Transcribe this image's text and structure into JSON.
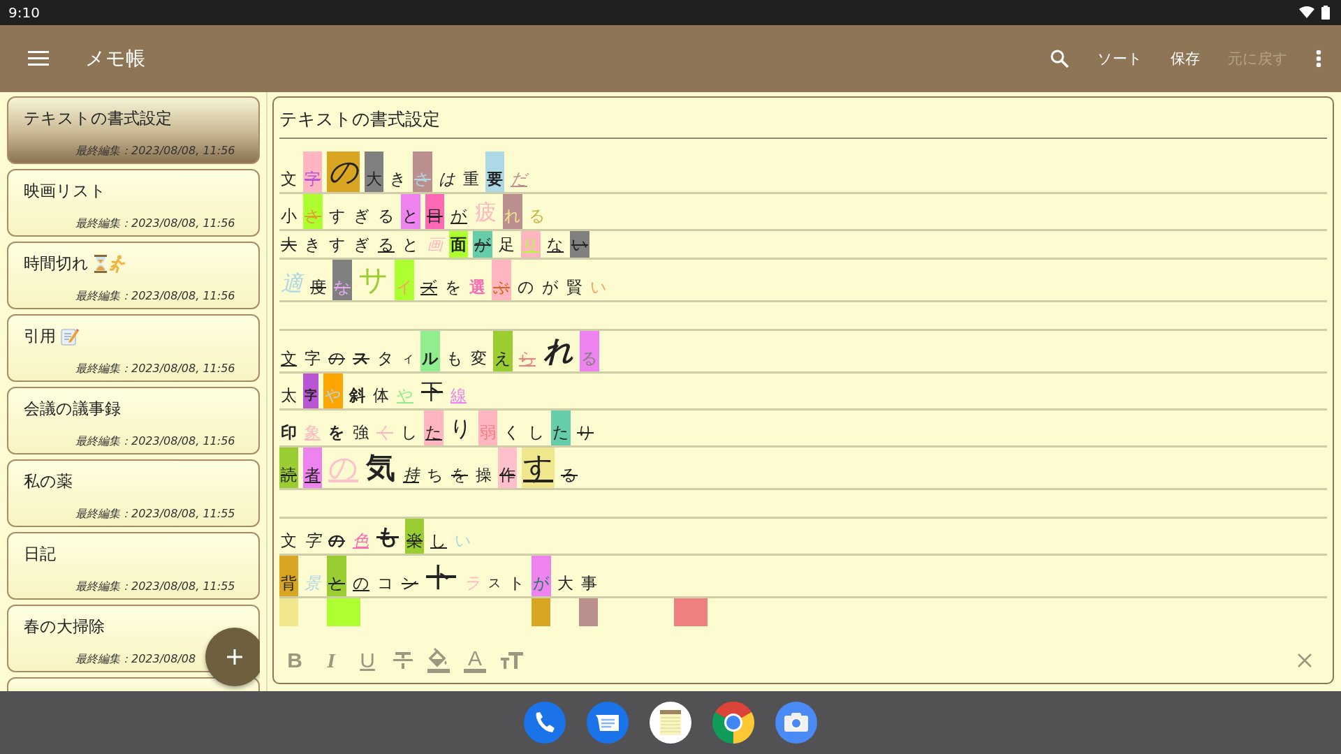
{
  "status_bar": {
    "time": "9:10"
  },
  "app_bar": {
    "title": "メモ帳",
    "actions": [
      {
        "label": "ソート",
        "disabled": false
      },
      {
        "label": "保存",
        "disabled": false
      },
      {
        "label": "元に戻す",
        "disabled": true
      }
    ]
  },
  "notes": [
    {
      "title": "テキストの書式設定",
      "edited": "最終編集：2023/08/08, 11:56",
      "selected": true
    },
    {
      "title": "映画リスト",
      "edited": "最終編集：2023/08/08, 11:56",
      "selected": false
    },
    {
      "title": "時間切れ",
      "icons": [
        {
          "kind": "hourglass"
        },
        {
          "kind": "runner"
        }
      ],
      "edited": "最終編集：2023/08/08, 11:56",
      "selected": false
    },
    {
      "title": "引用",
      "icons": [
        {
          "kind": "memo"
        }
      ],
      "edited": "最終編集：2023/08/08, 11:56",
      "selected": false
    },
    {
      "title": "会議の議事録",
      "edited": "最終編集：2023/08/08, 11:56",
      "selected": false
    },
    {
      "title": "私の薬",
      "edited": "最終編集：2023/08/08, 11:55",
      "selected": false
    },
    {
      "title": "日記",
      "edited": "最終編集：2023/08/08, 11:55",
      "selected": false
    },
    {
      "title": "春の大掃除",
      "edited": "最終編集：2023/08/08",
      "selected": false
    }
  ],
  "editor": {
    "title": "テキストの書式設定",
    "lines": [
      {
        "kind": "text",
        "chars": [
          {
            "t": "文",
            "kind": "normal"
          },
          {
            "t": "字",
            "kind": "normal",
            "highlight": {
              "color": "#ffb6c1"
            },
            "color": "#ba55d3",
            "strike": true
          },
          {
            "t": "の",
            "kind": "huge",
            "highlight": {
              "color": "#daa520"
            },
            "italic": true
          },
          {
            "t": "大",
            "kind": "normal",
            "highlight": {
              "color": "#808080"
            }
          },
          {
            "t": "き",
            "kind": "normal"
          },
          {
            "t": "さ",
            "kind": "normal",
            "highlight": {
              "color": "#bc8f8f"
            },
            "color": "#add8e6",
            "strike": true
          },
          {
            "t": "は",
            "kind": "normal",
            "italic": true
          },
          {
            "t": "重",
            "kind": "normal"
          },
          {
            "t": "要",
            "kind": "normal",
            "highlight": {
              "color": "#add8e6"
            },
            "bold": true
          },
          {
            "t": "だ",
            "kind": "normal",
            "color": "#bc8f8f",
            "italic": true,
            "underline": true
          }
        ]
      },
      {
        "kind": "text",
        "chars": [
          {
            "t": "小",
            "kind": "normal"
          },
          {
            "t": "さ",
            "kind": "normal",
            "highlight": {
              "color": "#adff2f"
            },
            "color": "#e0a030",
            "strike": true
          },
          {
            "t": "す",
            "kind": "normal"
          },
          {
            "t": "ぎ",
            "kind": "normal"
          },
          {
            "t": "る",
            "kind": "normal"
          },
          {
            "t": "と",
            "kind": "normal",
            "highlight": {
              "color": "#ee82ee"
            }
          },
          {
            "t": "目",
            "kind": "normal",
            "highlight": {
              "color": "#ff69b4"
            },
            "strike": true
          },
          {
            "t": "が",
            "kind": "normal",
            "underline": true
          },
          {
            "t": "疲",
            "kind": "large",
            "color": "#ffb6c1"
          },
          {
            "t": "れ",
            "kind": "normal",
            "highlight": {
              "color": "#bc8f8f"
            },
            "color": "#f0e68c"
          },
          {
            "t": "る",
            "kind": "normal",
            "color": "#c8b440"
          }
        ]
      },
      {
        "kind": "text",
        "chars": [
          {
            "t": "大",
            "kind": "normal",
            "strike": true
          },
          {
            "t": "き",
            "kind": "normal"
          },
          {
            "t": "す",
            "kind": "normal"
          },
          {
            "t": "ぎ",
            "kind": "normal"
          },
          {
            "t": "る",
            "kind": "normal",
            "underline": true
          },
          {
            "t": "と",
            "kind": "normal"
          },
          {
            "t": "画",
            "kind": "normal",
            "color": "#ffb6c1",
            "italic": true
          },
          {
            "t": "面",
            "kind": "normal",
            "highlight": {
              "color": "#adff2f"
            },
            "bold": true
          },
          {
            "t": "が",
            "kind": "normal",
            "highlight": {
              "color": "#66cdaa"
            },
            "strike": true
          },
          {
            "t": "足",
            "kind": "normal"
          },
          {
            "t": "り",
            "kind": "normal",
            "highlight": {
              "color": "#ffb6c1"
            },
            "color": "#adff2f",
            "underline": true
          },
          {
            "t": "な",
            "kind": "normal",
            "underline": true
          },
          {
            "t": "い",
            "kind": "normal",
            "highlight": {
              "color": "#808080"
            },
            "strike": true
          }
        ]
      },
      {
        "kind": "text",
        "chars": [
          {
            "t": "適",
            "kind": "large",
            "color": "#add8e6",
            "italic": true
          },
          {
            "t": "度",
            "kind": "normal",
            "strike": true
          },
          {
            "t": "な",
            "kind": "normal",
            "highlight": {
              "color": "#808080"
            },
            "color": "#e6a8f5",
            "strike": true
          },
          {
            "t": "サ",
            "kind": "huge",
            "color": "#9acd32"
          },
          {
            "t": "イ",
            "kind": "normal",
            "highlight": {
              "color": "#adff2f"
            },
            "color": "#f4a460"
          },
          {
            "t": "ズ",
            "kind": "normal",
            "underline": true,
            "strike": true
          },
          {
            "t": "を",
            "kind": "normal"
          },
          {
            "t": "選",
            "kind": "normal",
            "color": "#ff69b4",
            "bold": true
          },
          {
            "t": "ぶ",
            "kind": "normal",
            "highlight": {
              "color": "#ffb6c1"
            },
            "color": "#d2691e",
            "strike": true
          },
          {
            "t": "の",
            "kind": "normal"
          },
          {
            "t": "が",
            "kind": "normal"
          },
          {
            "t": "賢",
            "kind": "normal"
          },
          {
            "t": "い",
            "kind": "normal",
            "color": "#f4a460"
          }
        ]
      },
      {
        "kind": "blank"
      },
      {
        "kind": "text",
        "chars": [
          {
            "t": "文",
            "kind": "normal",
            "underline": true
          },
          {
            "t": "字",
            "kind": "normal"
          },
          {
            "t": "の",
            "kind": "normal",
            "strike": true
          },
          {
            "t": "ス",
            "kind": "normal",
            "strike": true,
            "bold": true
          },
          {
            "t": "タ",
            "kind": "normal"
          },
          {
            "t": "ィ",
            "kind": "small"
          },
          {
            "t": "ル",
            "kind": "normal",
            "highlight": {
              "color": "#90ee90"
            },
            "bold": true
          },
          {
            "t": "も",
            "kind": "normal"
          },
          {
            "t": "変",
            "kind": "normal"
          },
          {
            "t": "え",
            "kind": "normal",
            "highlight": {
              "color": "#9acd32"
            }
          },
          {
            "t": "ら",
            "kind": "normal",
            "color": "#f08080",
            "strike": true,
            "underline": true
          },
          {
            "t": "れ",
            "kind": "huge",
            "italic": true,
            "bold": true
          },
          {
            "t": "る",
            "kind": "normal",
            "highlight": {
              "color": "#ee82ee"
            },
            "color": "#808080"
          }
        ]
      },
      {
        "kind": "text",
        "chars": [
          {
            "t": "太",
            "kind": "normal"
          },
          {
            "t": "字",
            "kind": "small",
            "highlight": {
              "color": "#ba55d3"
            },
            "bold": true
          },
          {
            "t": "や",
            "kind": "normal",
            "highlight": {
              "color": "#ffa500"
            },
            "color": "#add8e6"
          },
          {
            "t": "斜",
            "kind": "normal",
            "bold": true
          },
          {
            "t": "体",
            "kind": "normal"
          },
          {
            "t": "や",
            "kind": "normal",
            "color": "#90ee90",
            "underline": true
          },
          {
            "t": "下",
            "kind": "large",
            "strike": true
          },
          {
            "t": "線",
            "kind": "normal",
            "color": "#ee82ee",
            "underline": true
          }
        ]
      },
      {
        "kind": "text",
        "chars": [
          {
            "t": "印",
            "kind": "normal",
            "bold": true
          },
          {
            "t": "象",
            "kind": "normal",
            "color": "#ffb6c1",
            "underline": true
          },
          {
            "t": "を",
            "kind": "normal",
            "bold": true
          },
          {
            "t": "強",
            "kind": "normal"
          },
          {
            "t": "く",
            "kind": "normal",
            "color": "#ffb6c1",
            "strike": true
          },
          {
            "t": "し",
            "kind": "normal"
          },
          {
            "t": "た",
            "kind": "normal",
            "highlight": {
              "color": "#ffb6c1"
            },
            "underline": true
          },
          {
            "t": "り",
            "kind": "large"
          },
          {
            "t": "弱",
            "kind": "normal",
            "highlight": {
              "color": "#ffb6c1"
            },
            "color": "#f08080"
          },
          {
            "t": "く",
            "kind": "normal"
          },
          {
            "t": "し",
            "kind": "normal"
          },
          {
            "t": "た",
            "kind": "normal",
            "highlight": {
              "color": "#66cdaa"
            }
          },
          {
            "t": "り",
            "kind": "normal",
            "strike": true
          }
        ]
      },
      {
        "kind": "text",
        "chars": [
          {
            "t": "読",
            "kind": "normal",
            "highlight": {
              "color": "#9acd32"
            },
            "strike": true
          },
          {
            "t": "者",
            "kind": "normal",
            "highlight": {
              "color": "#ee82ee"
            },
            "underline": true
          },
          {
            "t": "の",
            "kind": "huge",
            "color": "#ffc0cb",
            "underline": true
          },
          {
            "t": "気",
            "kind": "huge",
            "bold": true
          },
          {
            "t": "持",
            "kind": "normal",
            "italic": true,
            "underline": true
          },
          {
            "t": "ち",
            "kind": "normal"
          },
          {
            "t": "を",
            "kind": "normal",
            "strike": true
          },
          {
            "t": "操",
            "kind": "normal"
          },
          {
            "t": "作",
            "kind": "normal",
            "highlight": {
              "color": "#ffc0cb"
            },
            "strike": true
          },
          {
            "t": "す",
            "kind": "huge",
            "highlight": {
              "color": "#f0e68c"
            },
            "underline": true
          },
          {
            "t": "る",
            "kind": "normal",
            "strike": true
          }
        ]
      },
      {
        "kind": "blank"
      },
      {
        "kind": "text",
        "chars": [
          {
            "t": "文",
            "kind": "normal"
          },
          {
            "t": "字",
            "kind": "normal",
            "italic": true
          },
          {
            "t": "の",
            "kind": "normal",
            "strike": true,
            "bold": true
          },
          {
            "t": "色",
            "kind": "normal",
            "color": "#ff69b4",
            "italic": true,
            "underline": true
          },
          {
            "t": "も",
            "kind": "large",
            "bold": true,
            "strike": true
          },
          {
            "t": "楽",
            "kind": "normal",
            "highlight": {
              "color": "#9acd32"
            },
            "strike": true
          },
          {
            "t": "し",
            "kind": "normal",
            "underline": true
          },
          {
            "t": "い",
            "kind": "normal",
            "color": "#add8e6"
          }
        ]
      },
      {
        "kind": "text",
        "chars": [
          {
            "t": "背",
            "kind": "normal",
            "highlight": {
              "color": "#daa520"
            }
          },
          {
            "t": "景",
            "kind": "normal",
            "color": "#add8e6",
            "italic": true
          },
          {
            "t": "と",
            "kind": "normal",
            "highlight": {
              "color": "#9acd32"
            },
            "strike": true
          },
          {
            "t": "の",
            "kind": "normal",
            "underline": true
          },
          {
            "t": "コ",
            "kind": "normal"
          },
          {
            "t": "ン",
            "kind": "normal",
            "strike": true
          },
          {
            "t": "ト",
            "kind": "huge",
            "strike": true
          },
          {
            "t": "ラ",
            "kind": "normal",
            "color": "#ffb6c1",
            "italic": true
          },
          {
            "t": "ス",
            "kind": "small"
          },
          {
            "t": "ト",
            "kind": "normal"
          },
          {
            "t": "が",
            "kind": "normal",
            "highlight": {
              "color": "#ee82ee"
            },
            "color": "#1f7a5c"
          },
          {
            "t": "大",
            "kind": "normal"
          },
          {
            "t": "事",
            "kind": "normal"
          }
        ]
      },
      {
        "kind": "clipped",
        "chars": [
          {
            "kind": "block",
            "highlight": {
              "color": "#f0e68c"
            }
          },
          {
            "kind": "gap"
          },
          {
            "kind": "wide",
            "highlight": {
              "color": "#adff2f"
            }
          },
          {
            "kind": "gap"
          },
          {
            "kind": "gap"
          },
          {
            "kind": "gap"
          },
          {
            "kind": "gap"
          },
          {
            "kind": "gap"
          },
          {
            "kind": "gap"
          },
          {
            "kind": "gap"
          },
          {
            "kind": "block",
            "highlight": {
              "color": "#daa520"
            }
          },
          {
            "kind": "gap"
          },
          {
            "kind": "block",
            "highlight": {
              "color": "#bc8f8f"
            }
          },
          {
            "kind": "gap"
          },
          {
            "kind": "gap"
          },
          {
            "kind": "gap"
          },
          {
            "kind": "wide",
            "highlight": {
              "color": "#f08080"
            }
          }
        ]
      }
    ]
  },
  "toolbar": [
    {
      "kind": "bold",
      "glyph": "B"
    },
    {
      "kind": "italic",
      "glyph": "I"
    },
    {
      "kind": "underline",
      "glyph": "U"
    },
    {
      "kind": "strike"
    },
    {
      "kind": "fill"
    },
    {
      "kind": "color",
      "glyph": "A"
    },
    {
      "kind": "size"
    }
  ],
  "dock": [
    {
      "kind": "phone"
    },
    {
      "kind": "messages"
    },
    {
      "kind": "notepad"
    },
    {
      "kind": "browser"
    },
    {
      "kind": "camera"
    }
  ]
}
